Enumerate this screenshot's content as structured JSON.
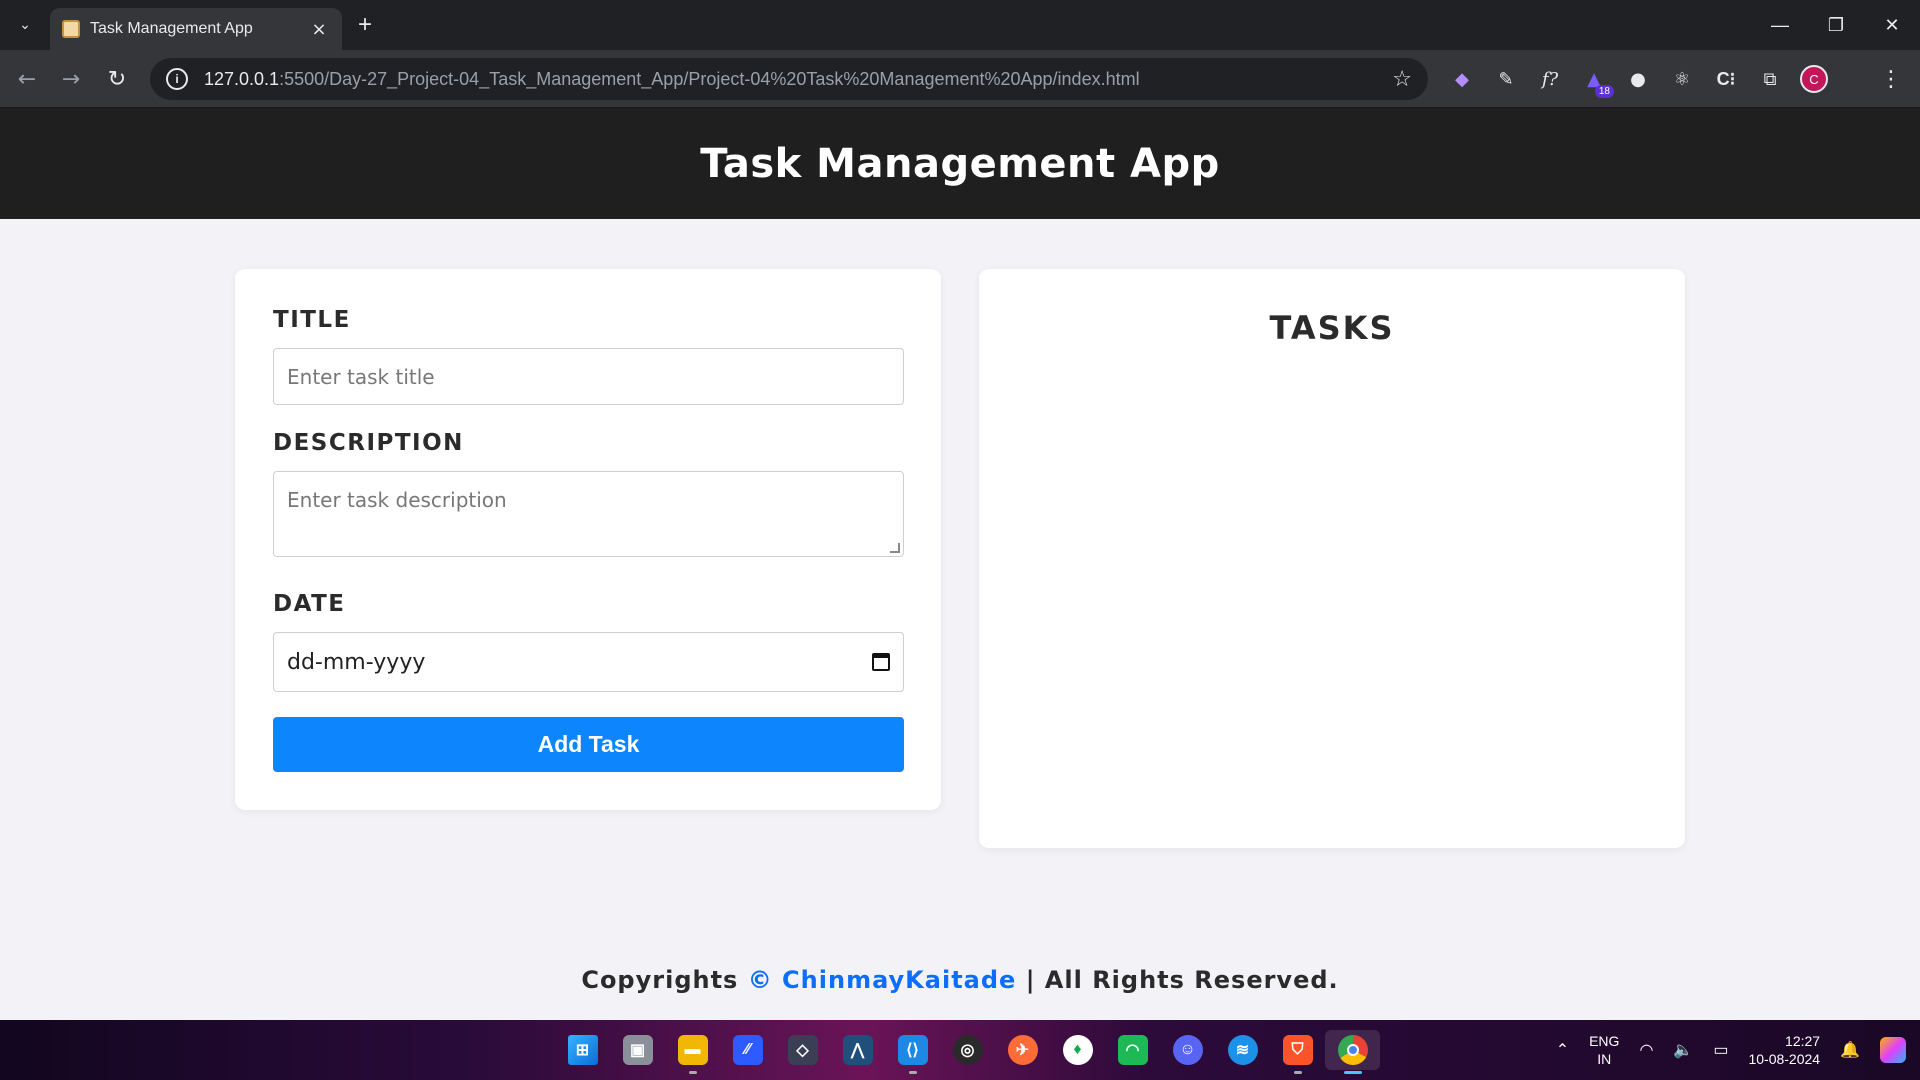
{
  "browser": {
    "tab_title": "Task Management App",
    "url_host": "127.0.0.1",
    "url_rest": ":5500/Day-27_Project-04_Task_Management_App/Project-04%20Task%20Management%20App/index.html",
    "extension_badge": "18",
    "profile_initial": "C"
  },
  "app": {
    "title": "Task Management App"
  },
  "form": {
    "title_label": "TITLE",
    "title_placeholder": "Enter task title",
    "description_label": "DESCRIPTION",
    "description_placeholder": "Enter task description",
    "date_label": "DATE",
    "date_value": "dd-mm-yyyy",
    "add_button": "Add Task"
  },
  "tasks": {
    "heading": "TASKS",
    "items": []
  },
  "footer": {
    "prefix": "Copyrights",
    "brand": "© ChinmayKaitade",
    "suffix": "| All Rights Reserved."
  },
  "taskbar": {
    "lang_line1": "ENG",
    "lang_line2": "IN",
    "time": "12:27",
    "date": "10-08-2024"
  },
  "colors": {
    "header_bg": "#1f1f1f",
    "page_bg": "#f3f3f7",
    "primary_button": "#0d85fd",
    "brand_link": "#0d6efd"
  }
}
